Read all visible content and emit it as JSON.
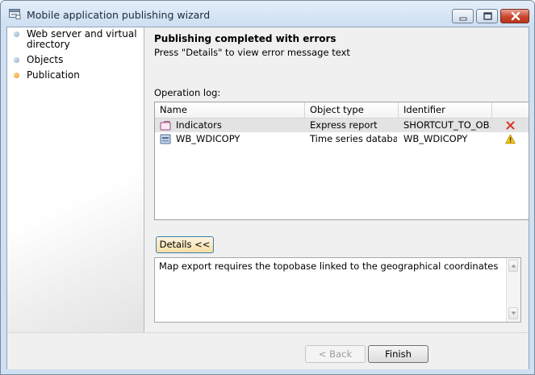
{
  "window": {
    "title": "Mobile application publishing wizard"
  },
  "sidebar": {
    "steps": [
      {
        "label": "Web server and virtual directory",
        "state": "done"
      },
      {
        "label": "Objects",
        "state": "done"
      },
      {
        "label": "Publication",
        "state": "active"
      }
    ]
  },
  "main": {
    "heading": "Publishing completed with errors",
    "subheading": "Press \"Details\" to view error message text",
    "log_label": "Operation log:",
    "columns": [
      "Name",
      "Object type",
      "Identifier"
    ],
    "rows": [
      {
        "name": "Indicators",
        "type": "Express report",
        "identifier": "SHORTCUT_TO_OB...",
        "icon": "express-report-icon",
        "status": "error",
        "status_icon": "error-x-icon"
      },
      {
        "name": "WB_WDICOPY",
        "type": "Time series database",
        "identifier": "WB_WDICOPY",
        "icon": "database-icon",
        "status": "warning",
        "status_icon": "warning-icon"
      }
    ],
    "details_button": "Details <<",
    "details_text": "Map export requires the topobase linked to the geographical coordinates"
  },
  "footer": {
    "back_button": "< Back",
    "finish_button": "Finish"
  },
  "colors": {
    "error": "#d9342b",
    "warning": "#e8b400",
    "active_step": "#f29b24"
  }
}
